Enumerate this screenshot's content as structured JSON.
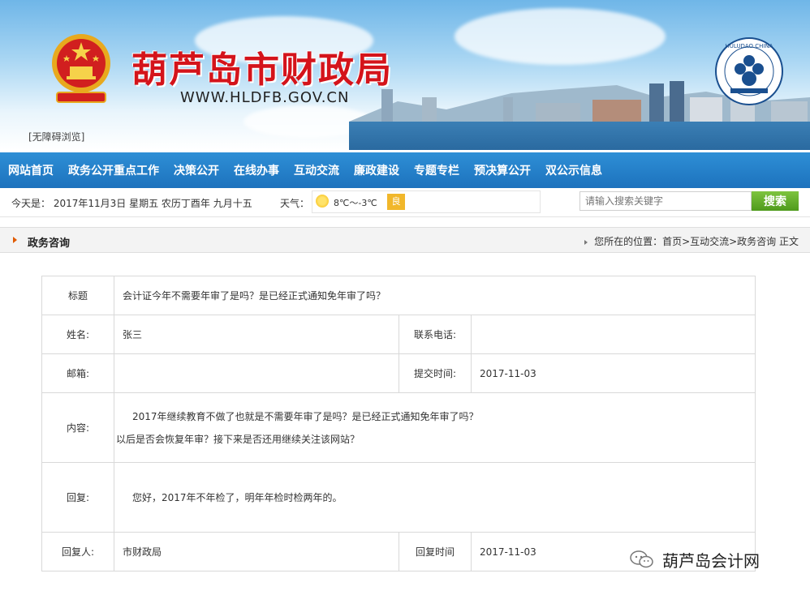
{
  "header": {
    "site_title": "葫芦岛市财政局",
    "site_url": "WWW.HLDFB.GOV.CN",
    "accessibility_link": "[无障碍浏览]",
    "logo_text": "HULUDAO CHINA"
  },
  "nav": {
    "items": [
      {
        "label": "网站首页"
      },
      {
        "label": "政务公开重点工作"
      },
      {
        "label": "决策公开"
      },
      {
        "label": "在线办事"
      },
      {
        "label": "互动交流"
      },
      {
        "label": "廉政建设"
      },
      {
        "label": "专题专栏"
      },
      {
        "label": "预决算公开"
      },
      {
        "label": "双公示信息"
      }
    ]
  },
  "infobar": {
    "today": "今天是： 2017年11月3日 星期五 农历丁酉年 九月十五",
    "weather_label": "天气：",
    "temperature": "8℃～-3℃",
    "air_quality": "良",
    "search_placeholder": "请输入搜索关键字",
    "search_button": "搜索"
  },
  "section": {
    "title": "政务咨询",
    "breadcrumb": "您所在的位置：首页>互动交流>政务咨询 正文"
  },
  "detail": {
    "title_label": "标题",
    "title_value": "会计证今年不需要年审了是吗？是已经正式通知免年审了吗？",
    "name_label": "姓名:",
    "name_value": "张三",
    "phone_label": "联系电话:",
    "phone_value": "",
    "email_label": "邮箱:",
    "email_value": "",
    "submit_time_label": "提交时间:",
    "submit_time_value": "2017-11-03",
    "content_label": "内容:",
    "content_line1": "2017年继续教育不做了也就是不需要年审了是吗？是已经正式通知免年审了吗？",
    "content_line2": "以后是否会恢复年审？接下来是否还用继续关注该网站？",
    "reply_label": "回复:",
    "reply_value": "您好，2017年不年检了，明年年检时检两年的。",
    "replier_label": "回复人:",
    "replier_value": "市财政局",
    "reply_time_label": "回复时间",
    "reply_time_value": "2017-11-03"
  },
  "watermark": {
    "text": "葫芦岛会计网"
  },
  "colors": {
    "title_red": "#d4141b",
    "nav_blue": "#1d72bd",
    "search_green": "#5aa826",
    "section_icon": "#e05a00"
  }
}
